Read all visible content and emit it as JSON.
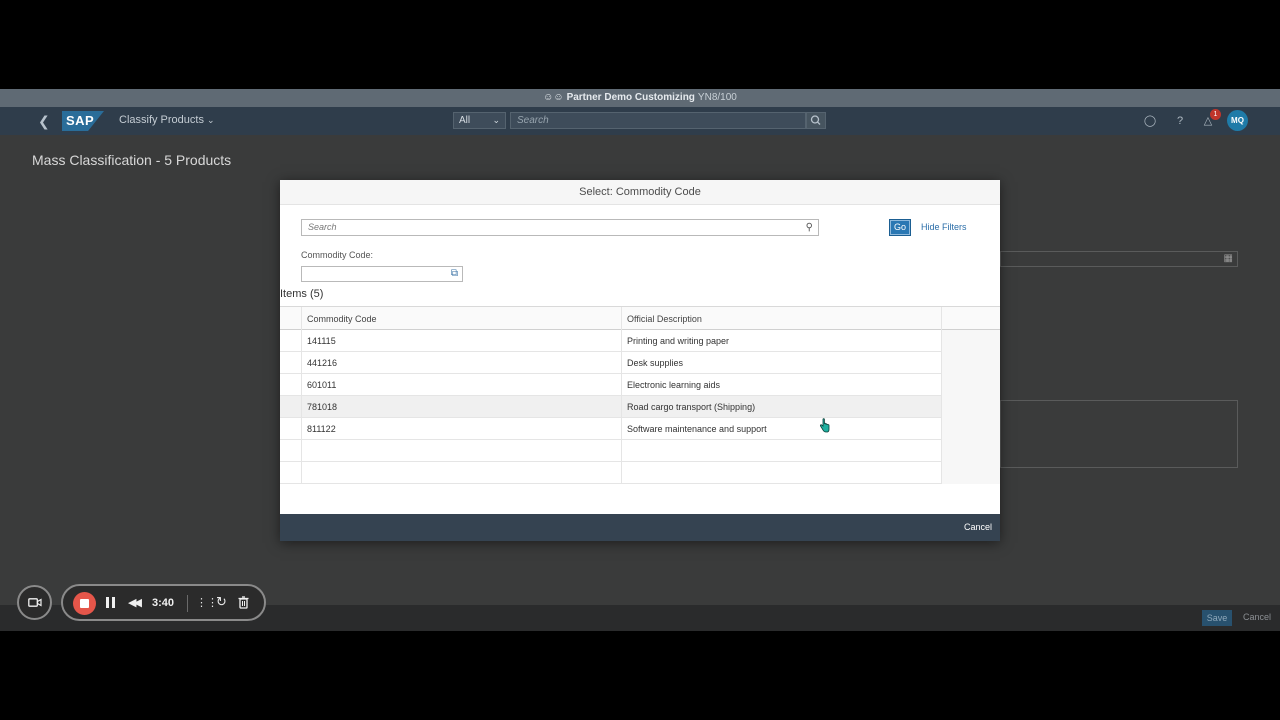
{
  "window": {
    "title": "Partner Demo Customizing",
    "system": "YN8/100"
  },
  "shell": {
    "logo": "SAP",
    "app_title": "Classify Products",
    "scope": "All",
    "search_placeholder": "Search",
    "notification_count": "1",
    "avatar_initials": "MQ"
  },
  "page": {
    "title": "Mass Classification - 5 Products",
    "footer": {
      "save_label": "Save",
      "cancel_label": "Cancel"
    }
  },
  "dialog": {
    "title": "Select: Commodity Code",
    "search_placeholder": "Search",
    "go_label": "Go",
    "hide_filters_label": "Hide Filters",
    "commodity_code_label": "Commodity Code:",
    "commodity_code_value": "",
    "items_label": "Items (5)",
    "columns": [
      "Commodity Code",
      "Official Description"
    ],
    "rows": [
      {
        "code": "141115",
        "description": "Printing and writing paper"
      },
      {
        "code": "441216",
        "description": "Desk supplies"
      },
      {
        "code": "601011",
        "description": "Electronic learning aids"
      },
      {
        "code": "781018",
        "description": "Road cargo transport (Shipping)"
      },
      {
        "code": "811122",
        "description": "Software maintenance and support"
      }
    ],
    "cancel_label": "Cancel"
  },
  "recorder": {
    "time": "3:40"
  },
  "colors": {
    "shell": "#2f3d4b",
    "accent": "#2a77b3",
    "record": "#e5564a"
  }
}
